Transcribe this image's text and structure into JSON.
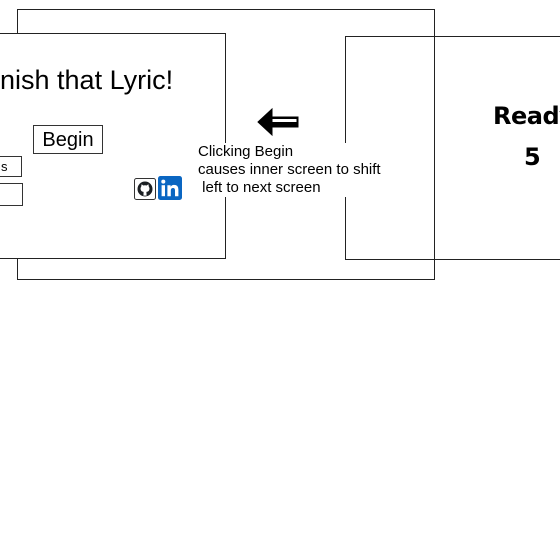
{
  "left_screen": {
    "title": "nish that Lyric!",
    "begin_label": "Begin",
    "input_1_text": "s",
    "input_2_text": ""
  },
  "annotation": {
    "caption": "Clicking Begin\ncauses inner screen to shift\n left to next screen",
    "arrow_icon": "left-arrow-icon"
  },
  "right_screen": {
    "ready_text": "Ready",
    "countdown": "5"
  },
  "icons": [
    "github-icon",
    "linkedin-icon",
    "left-arrow-icon"
  ],
  "colors": {
    "linkedin_blue": "#0a66c2",
    "border": "#222222"
  }
}
